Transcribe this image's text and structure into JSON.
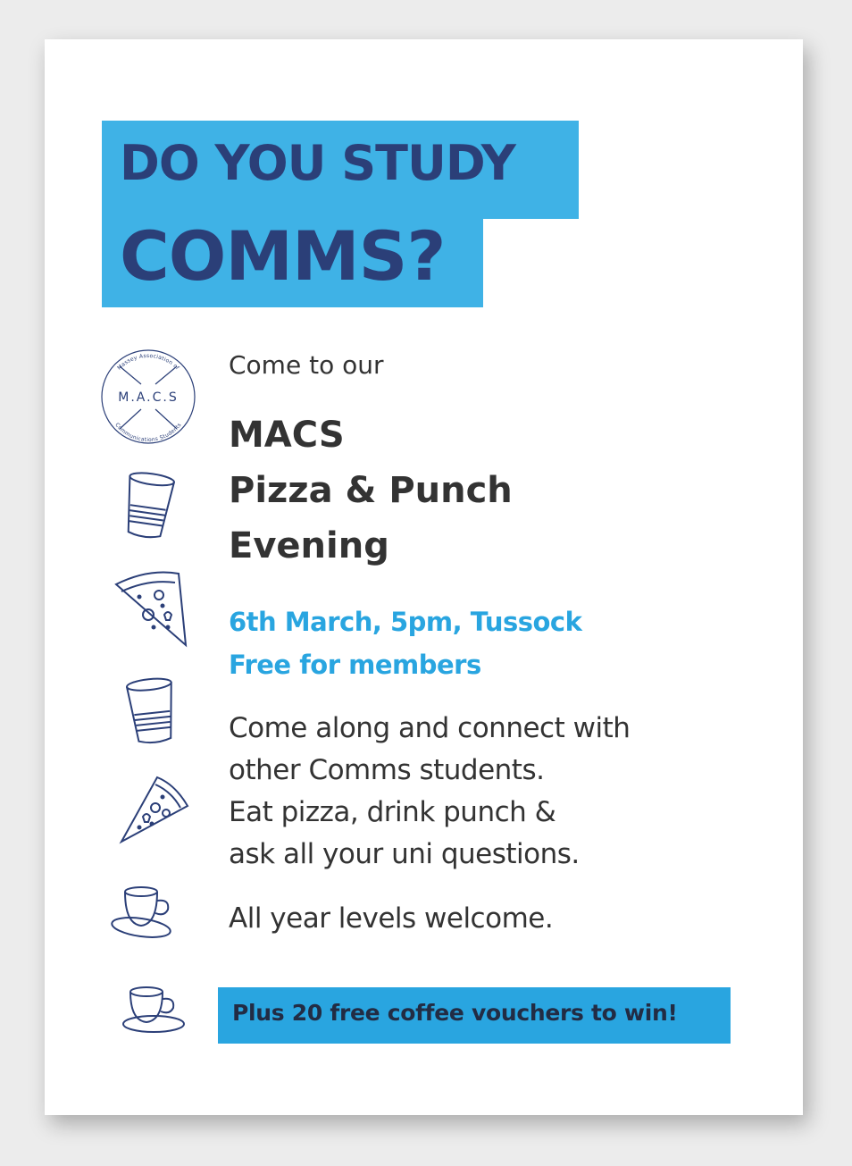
{
  "headline": {
    "line1": "DO YOU STUDY",
    "line2": "COMMS?"
  },
  "logo": {
    "center_text": "M.A.C.S",
    "ring_top": "Massey Association of",
    "ring_bottom": "Communications Students",
    "icon": "macs-logo"
  },
  "intro": "Come to our",
  "event_title": {
    "line1": "MACS",
    "line2": "Pizza & Punch",
    "line3": "Evening"
  },
  "details": {
    "line1": "6th March, 5pm, Tussock",
    "line2": "Free for members"
  },
  "body": {
    "line1": "Come along and connect with",
    "line2": "other Comms students.",
    "line3": "Eat pizza, drink punch &",
    "line4": "ask all your uni questions."
  },
  "welcome": "All year levels welcome.",
  "cta": "Plus 20 free coffee vouchers to win!",
  "icons": [
    "macs-logo",
    "cup-icon",
    "pizza-slice-icon",
    "cup-icon",
    "pizza-slice-icon",
    "coffee-cup-icon",
    "coffee-cup-icon"
  ],
  "colors": {
    "headline_bg": "#3fb2e6",
    "headline_text": "#2b3f78",
    "accent": "#29a5e0",
    "body_text": "#333333",
    "icon_stroke": "#2b3f78"
  }
}
